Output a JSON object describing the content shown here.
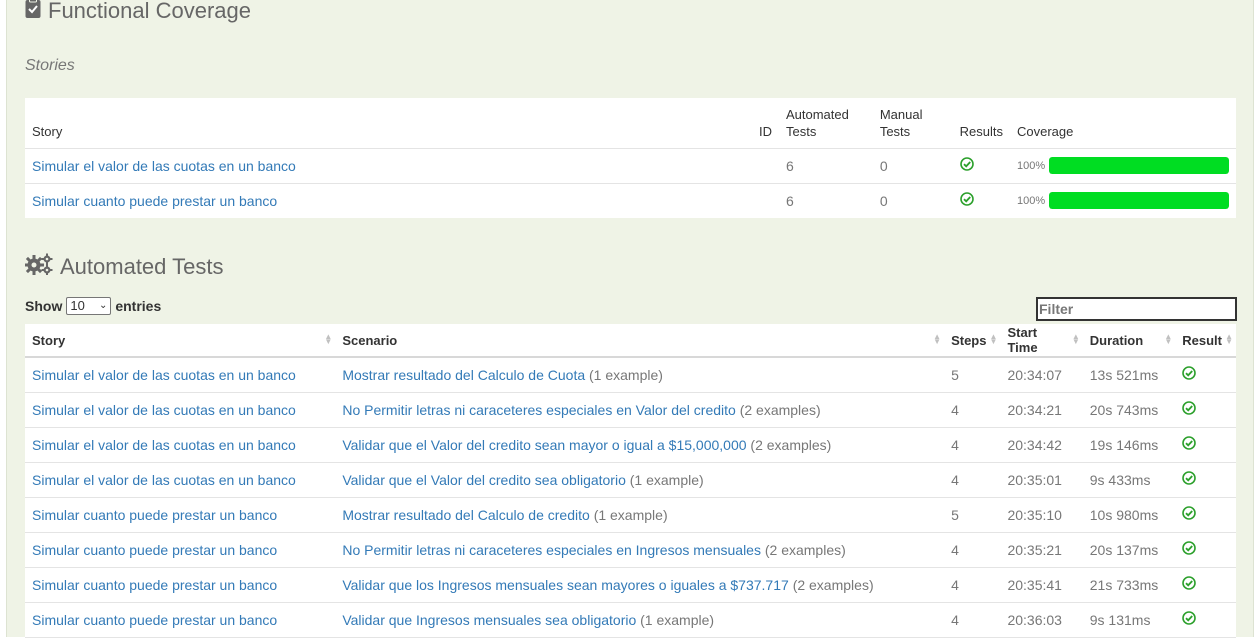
{
  "functional_coverage": {
    "title": "Functional Coverage",
    "subtitle": "Stories",
    "columns": {
      "story": "Story",
      "id": "ID",
      "automated_1": "Automated",
      "automated_2": "Tests",
      "manual_1": "Manual",
      "manual_2": "Tests",
      "results": "Results",
      "coverage": "Coverage"
    },
    "rows": [
      {
        "story": "Simular el valor de las cuotas en un banco",
        "id": "",
        "automated": "6",
        "manual": "0",
        "coverage_pct": "100%",
        "coverage_fraction": 1.0
      },
      {
        "story": "Simular cuanto puede prestar un banco",
        "id": "",
        "automated": "6",
        "manual": "0",
        "coverage_pct": "100%",
        "coverage_fraction": 1.0
      }
    ]
  },
  "automated_tests": {
    "title": "Automated Tests",
    "show_label": "Show",
    "entries_value": "10",
    "entries_label": "entries",
    "filter_placeholder": "Filter",
    "columns": {
      "story": "Story",
      "scenario": "Scenario",
      "steps": "Steps",
      "start_time": "Start Time",
      "duration": "Duration",
      "result": "Result"
    },
    "rows": [
      {
        "story": "Simular el valor de las cuotas en un banco",
        "scenario": "Mostrar resultado del Calculo de Cuota",
        "examples": "(1 example)",
        "steps": "5",
        "start_time": "20:34:07",
        "duration": "13s 521ms"
      },
      {
        "story": "Simular el valor de las cuotas en un banco",
        "scenario": "No Permitir letras ni caraceteres especiales en Valor del credito",
        "examples": "(2 examples)",
        "steps": "4",
        "start_time": "20:34:21",
        "duration": "20s 743ms"
      },
      {
        "story": "Simular el valor de las cuotas en un banco",
        "scenario": "Validar que el Valor del credito sean mayor o igual a $15,000,000",
        "examples": "(2 examples)",
        "steps": "4",
        "start_time": "20:34:42",
        "duration": "19s 146ms"
      },
      {
        "story": "Simular el valor de las cuotas en un banco",
        "scenario": "Validar que el Valor del credito sea obligatorio",
        "examples": "(1 example)",
        "steps": "4",
        "start_time": "20:35:01",
        "duration": "9s 433ms"
      },
      {
        "story": "Simular cuanto puede prestar un banco",
        "scenario": "Mostrar resultado del Calculo de credito",
        "examples": "(1 example)",
        "steps": "5",
        "start_time": "20:35:10",
        "duration": "10s 980ms"
      },
      {
        "story": "Simular cuanto puede prestar un banco",
        "scenario": "No Permitir letras ni caraceteres especiales en Ingresos mensuales",
        "examples": "(2 examples)",
        "steps": "4",
        "start_time": "20:35:21",
        "duration": "20s 137ms"
      },
      {
        "story": "Simular cuanto puede prestar un banco",
        "scenario": "Validar que los Ingresos mensuales sean mayores o iguales a $737.717",
        "examples": "(2 examples)",
        "steps": "4",
        "start_time": "20:35:41",
        "duration": "21s 733ms"
      },
      {
        "story": "Simular cuanto puede prestar un banco",
        "scenario": "Validar que Ingresos mensuales sea obligatorio",
        "examples": "(1 example)",
        "steps": "4",
        "start_time": "20:36:03",
        "duration": "9s 131ms"
      }
    ]
  },
  "colors": {
    "link": "#337ab7",
    "success": "#2ca02c",
    "coverage_bar": "#00dd22"
  },
  "icons": {
    "section_1": "clipboard-check-icon",
    "section_2": "gears-icon",
    "result": "check-circle-icon"
  }
}
